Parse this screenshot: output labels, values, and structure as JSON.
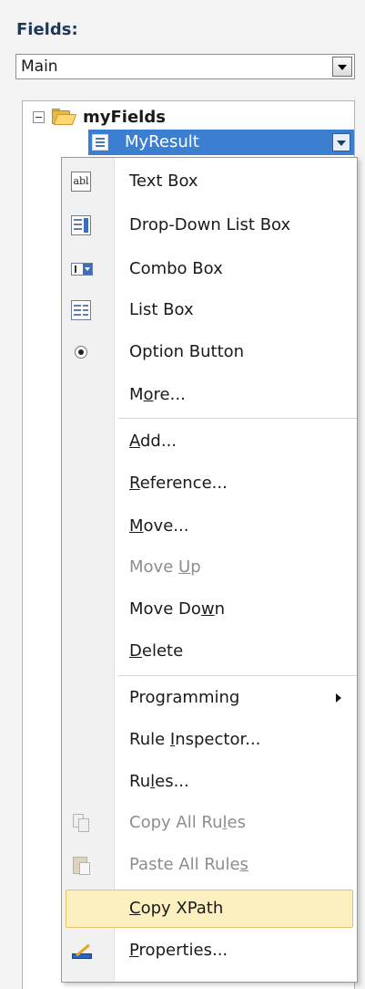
{
  "fields_label": "Fields:",
  "data_source": {
    "selected": "Main"
  },
  "tree": {
    "root_label": "myFields",
    "selected_node": "MyResult"
  },
  "menu": {
    "text_box": {
      "pre": "Text Box",
      "u": "",
      "post": ""
    },
    "drop_down": {
      "pre": "Drop-Down List Box",
      "u": "",
      "post": ""
    },
    "combo_box": {
      "pre": "Combo Box",
      "u": "",
      "post": ""
    },
    "list_box": {
      "pre": "List Box",
      "u": "",
      "post": ""
    },
    "option_button": {
      "pre": "Option Button",
      "u": "",
      "post": ""
    },
    "more": {
      "pre": "M",
      "u": "o",
      "post": "re..."
    },
    "add": {
      "pre": "",
      "u": "A",
      "post": "dd..."
    },
    "reference": {
      "pre": "",
      "u": "R",
      "post": "eference..."
    },
    "move": {
      "pre": "",
      "u": "M",
      "post": "ove..."
    },
    "move_up": {
      "pre": "Move ",
      "u": "U",
      "post": "p"
    },
    "move_down": {
      "pre": "Move Do",
      "u": "w",
      "post": "n"
    },
    "delete": {
      "pre": "",
      "u": "D",
      "post": "elete"
    },
    "programming": {
      "pre": "Programming",
      "u": "",
      "post": ""
    },
    "rule_inspector": {
      "pre": "Rule ",
      "u": "I",
      "post": "nspector..."
    },
    "rules": {
      "pre": "Ru",
      "u": "l",
      "post": "es..."
    },
    "copy_all_rules": {
      "pre": "Copy All Ru",
      "u": "l",
      "post": "es"
    },
    "paste_all_rules": {
      "pre": "Paste All Rule",
      "u": "s",
      "post": ""
    },
    "copy_xpath": {
      "pre": "",
      "u": "C",
      "post": "opy XPath"
    },
    "properties": {
      "pre": "",
      "u": "P",
      "post": "roperties..."
    }
  }
}
